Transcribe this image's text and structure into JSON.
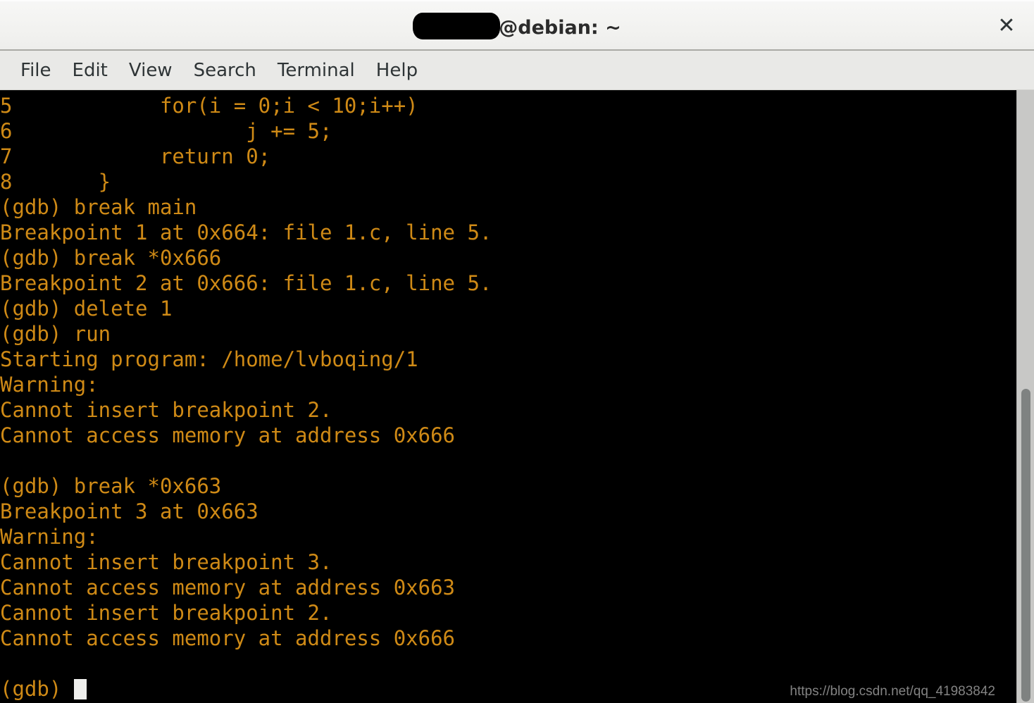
{
  "window": {
    "title_redacted_user": "",
    "title_suffix": "@debian: ~",
    "close_label": "✕"
  },
  "menubar": {
    "items": [
      {
        "label": "File",
        "name": "menu-file"
      },
      {
        "label": "Edit",
        "name": "menu-edit"
      },
      {
        "label": "View",
        "name": "menu-view"
      },
      {
        "label": "Search",
        "name": "menu-search"
      },
      {
        "label": "Terminal",
        "name": "menu-terminal"
      },
      {
        "label": "Help",
        "name": "menu-help"
      }
    ]
  },
  "terminal": {
    "foreground_color": "#cf8a16",
    "background_color": "#000000",
    "cursor_color": "#eeeeec",
    "lines": [
      "5            for(i = 0;i < 10;i++)",
      "6                   j += 5;",
      "7            return 0;",
      "8       }",
      "(gdb) break main",
      "Breakpoint 1 at 0x664: file 1.c, line 5.",
      "(gdb) break *0x666",
      "Breakpoint 2 at 0x666: file 1.c, line 5.",
      "(gdb) delete 1",
      "(gdb) run",
      "Starting program: /home/lvboqing/1",
      "Warning:",
      "Cannot insert breakpoint 2.",
      "Cannot access memory at address 0x666",
      "",
      "(gdb) break *0x663",
      "Breakpoint 3 at 0x663",
      "Warning:",
      "Cannot insert breakpoint 3.",
      "Cannot access memory at address 0x663",
      "Cannot insert breakpoint 2.",
      "Cannot access memory at address 0x666",
      ""
    ],
    "prompt": "(gdb) "
  },
  "watermark": {
    "text": "https://blog.csdn.net/qq_41983842"
  }
}
